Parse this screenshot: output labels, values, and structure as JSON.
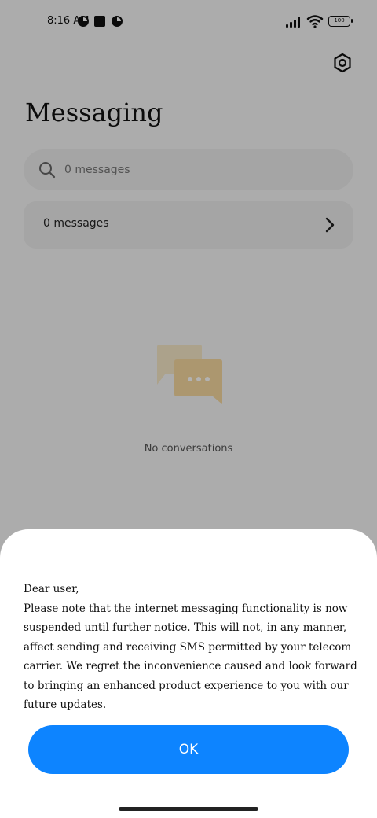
{
  "status_bar": {
    "time": "8:16 AM",
    "battery_level": "100",
    "icons": [
      "notification-icon",
      "square-app-icon",
      "notification-icon",
      "signal-icon",
      "wifi-icon",
      "battery-icon"
    ]
  },
  "header": {
    "title": "Messaging",
    "settings_icon": "settings-icon"
  },
  "search": {
    "placeholder": "0 messages",
    "icon": "search-icon"
  },
  "filter_row": {
    "label": "0 messages",
    "icon": "chevron-right-icon"
  },
  "empty_state": {
    "icon": "chat-bubbles-icon",
    "text": "No conversations"
  },
  "dialog": {
    "greeting": "Dear user,",
    "message": "Please note that the internet messaging functionality is now suspended until further notice. This will not, in any manner, affect sending and receiving SMS permitted by your telecom carrier. We regret the inconvenience caused and look forward to bringing an enhanced product experience to you with our future updates.",
    "ok_label": "OK"
  },
  "colors": {
    "accent": "#0d84ff",
    "scrim": "rgba(0,0,0,0.3)",
    "illustration_back": "#f6e8c8",
    "illustration_front": "#f7d9a0"
  }
}
